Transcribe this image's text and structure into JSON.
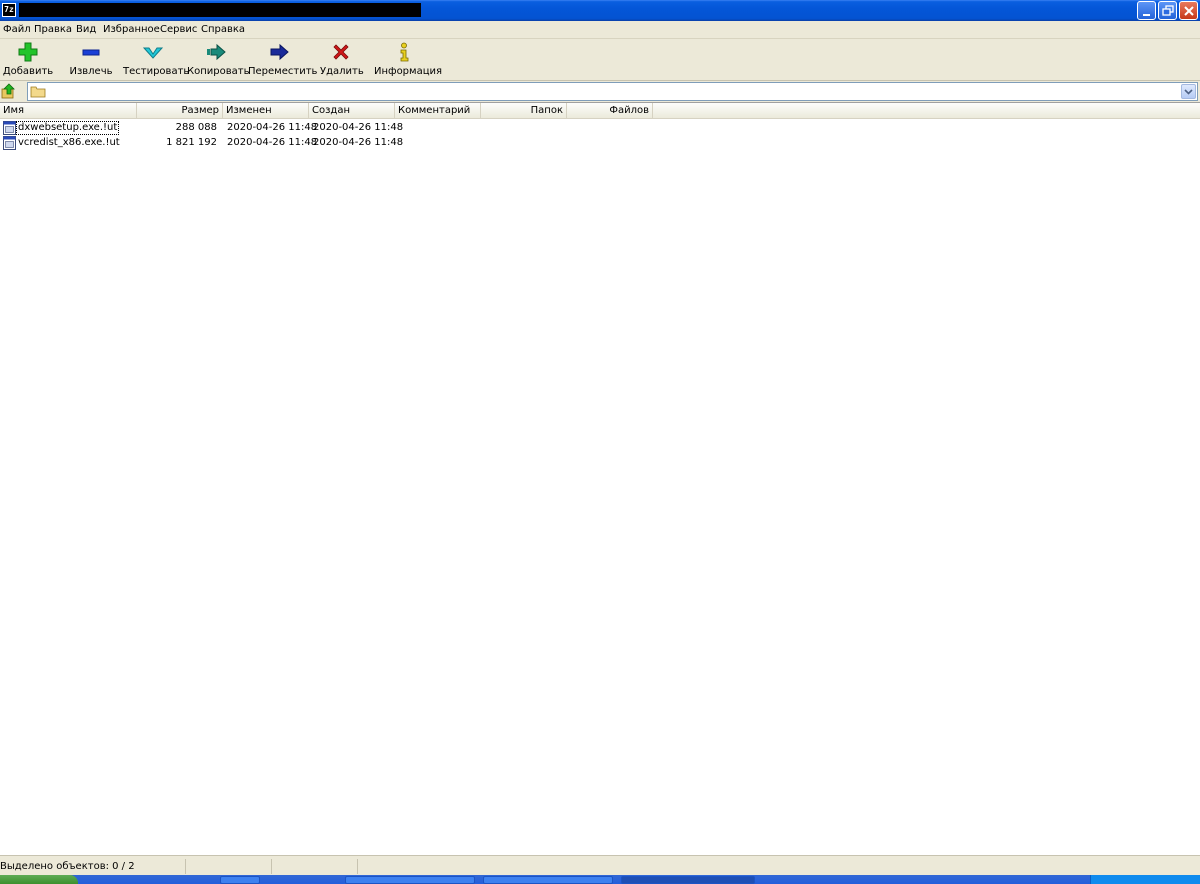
{
  "window": {
    "app_icon_label": "7z",
    "title": ""
  },
  "menu": [
    "Файл",
    "Правка",
    "Вид",
    "Избранное",
    "Сервис",
    "Справка"
  ],
  "toolbar": {
    "add": "Добавить",
    "extract": "Извлечь",
    "test": "Тестировать",
    "copy": "Копировать",
    "move": "Переместить",
    "delete": "Удалить",
    "info": "Информация"
  },
  "address": {
    "value": ""
  },
  "columns": {
    "name": "Имя",
    "size": "Размер",
    "modified": "Изменен",
    "created": "Создан",
    "comment": "Комментарий",
    "folders": "Папок",
    "files": "Файлов"
  },
  "files": [
    {
      "name": "dxwebsetup.exe.!ut",
      "size": "288 088",
      "modified": "2020-04-26 11:48",
      "created": "2020-04-26 11:48"
    },
    {
      "name": "vcredist_x86.exe.!ut",
      "size": "1 821 192",
      "modified": "2020-04-26 11:48",
      "created": "2020-04-26 11:48"
    }
  ],
  "status": {
    "selected": "Выделено объектов: 0 / 2"
  },
  "colors": {
    "titlebar": "#0456d8",
    "chrome": "#ece9d8",
    "add_icon": "#22c42a",
    "extract_icon": "#1a3fd6",
    "test_icon": "#20c8d8",
    "copy_icon": "#1a8a7a",
    "move_icon": "#1a2a9a",
    "delete_icon": "#d01818",
    "info_icon": "#e8d020"
  }
}
